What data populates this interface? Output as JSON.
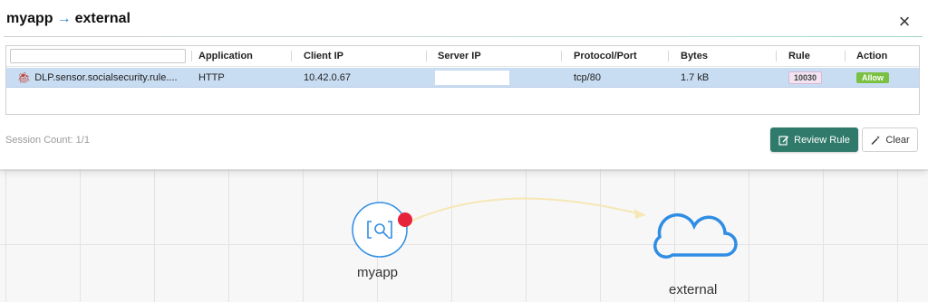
{
  "dialog": {
    "title_source": "myapp",
    "title_arrow": "→",
    "title_dest": "external",
    "close_icon": "×"
  },
  "table": {
    "columns": [
      "Application",
      "Client IP",
      "Server IP",
      "Protocol/Port",
      "Bytes",
      "Rule",
      "Action"
    ],
    "rows": [
      {
        "name": "DLP.sensor.socialsecurity.rule....",
        "application": "HTTP",
        "client_ip": "10.42.0.67",
        "server_ip": "",
        "protocol_port": "tcp/80",
        "bytes": "1.7 kB",
        "rule": "10030",
        "action": "Allow"
      }
    ]
  },
  "footer": {
    "session_count": "Session Count: 1/1",
    "review_rule_label": "Review Rule",
    "clear_label": "Clear"
  },
  "graph": {
    "source_label": "myapp",
    "dest_label": "external",
    "accent": "#2f8de4",
    "alert_color": "#e5243b",
    "edge_color": "#f6e7b4"
  }
}
